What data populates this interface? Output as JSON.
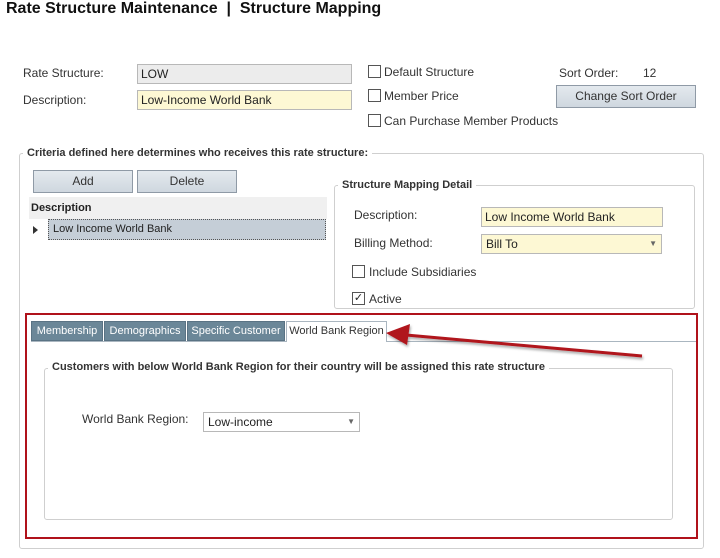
{
  "header": {
    "title": "Rate Structure Maintenance  |  Structure Mapping"
  },
  "form": {
    "rate_structure_label": "Rate Structure:",
    "rate_structure_value": "LOW",
    "description_label": "Description:",
    "description_value": "Low-Income World Bank",
    "default_structure_label": "Default Structure",
    "member_price_label": "Member Price",
    "can_purchase_label": "Can Purchase Member Products",
    "sort_order_label": "Sort Order:",
    "sort_order_value": "12",
    "change_sort_order_label": "Change Sort Order"
  },
  "criteria": {
    "legend": "Criteria defined here determines who receives this rate structure:",
    "add_label": "Add",
    "delete_label": "Delete",
    "grid_header": "Description",
    "rows": [
      "Low Income World Bank"
    ]
  },
  "detail": {
    "legend": "Structure Mapping Detail",
    "description_label": "Description:",
    "description_value": "Low Income World Bank",
    "billing_method_label": "Billing Method:",
    "billing_method_value": "Bill To",
    "include_subsidiaries_label": "Include Subsidiaries",
    "active_label": "Active",
    "active_checked": "✓"
  },
  "tabs": [
    {
      "label": "Membership"
    },
    {
      "label": "Demographics"
    },
    {
      "label": "Specific Customer"
    },
    {
      "label": "World Bank Region"
    }
  ],
  "world_bank": {
    "legend": "Customers with below World Bank Region for their country will be assigned this rate structure",
    "region_label": "World Bank Region:",
    "region_value": "Low-income"
  },
  "annotation": {
    "color": "#b0121b"
  }
}
